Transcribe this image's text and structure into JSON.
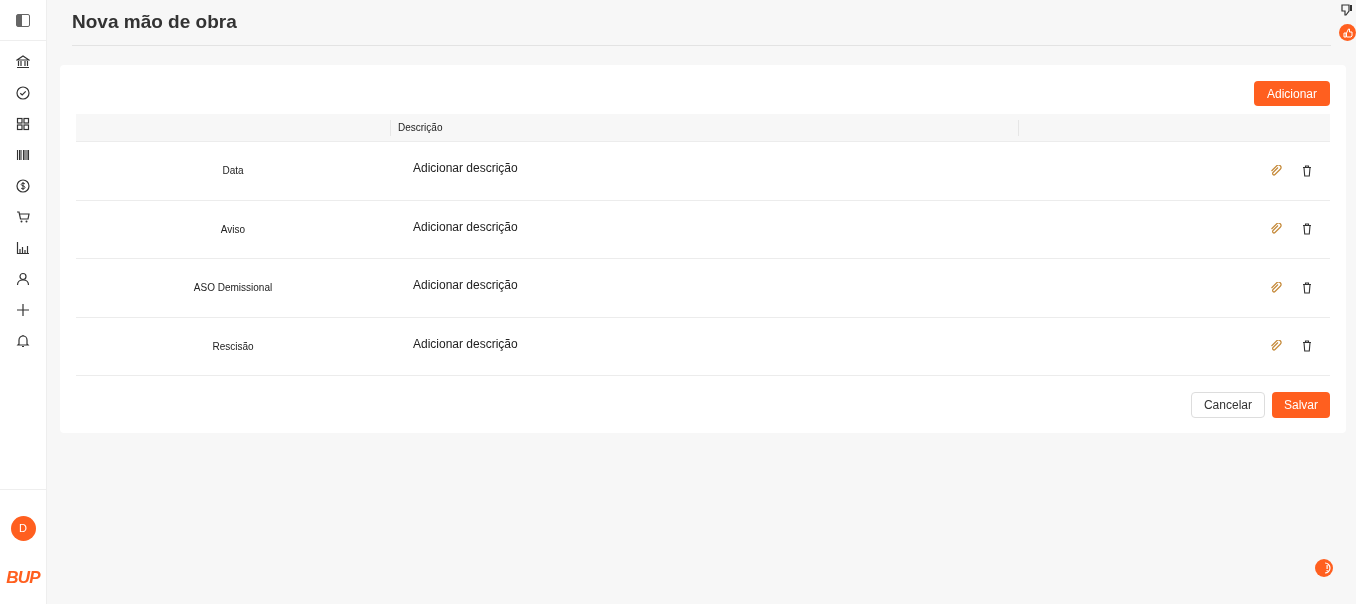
{
  "page": {
    "title": "Nova mão de obra"
  },
  "sidebar": {
    "items": [
      {
        "kind": "bank"
      },
      {
        "kind": "check"
      },
      {
        "kind": "grid"
      },
      {
        "kind": "barcode"
      },
      {
        "kind": "dollar"
      },
      {
        "kind": "cart"
      },
      {
        "kind": "chart"
      },
      {
        "kind": "user"
      },
      {
        "kind": "plus"
      },
      {
        "kind": "bell"
      }
    ],
    "avatar": "D",
    "logo": "BUP"
  },
  "add_button": "Adicionar",
  "table": {
    "columns": [
      "",
      "Descrição",
      ""
    ],
    "rows": [
      {
        "name": "Data",
        "description": "Adicionar descrição"
      },
      {
        "name": "Aviso",
        "description": "Adicionar descrição"
      },
      {
        "name": "ASO Demissional",
        "description": "Adicionar descrição"
      },
      {
        "name": "Rescisão",
        "description": "Adicionar descrição"
      }
    ]
  },
  "buttons": [
    {
      "label": "Cancelar",
      "kind": "secondary"
    },
    {
      "label": "Salvar",
      "kind": "primary"
    }
  ]
}
